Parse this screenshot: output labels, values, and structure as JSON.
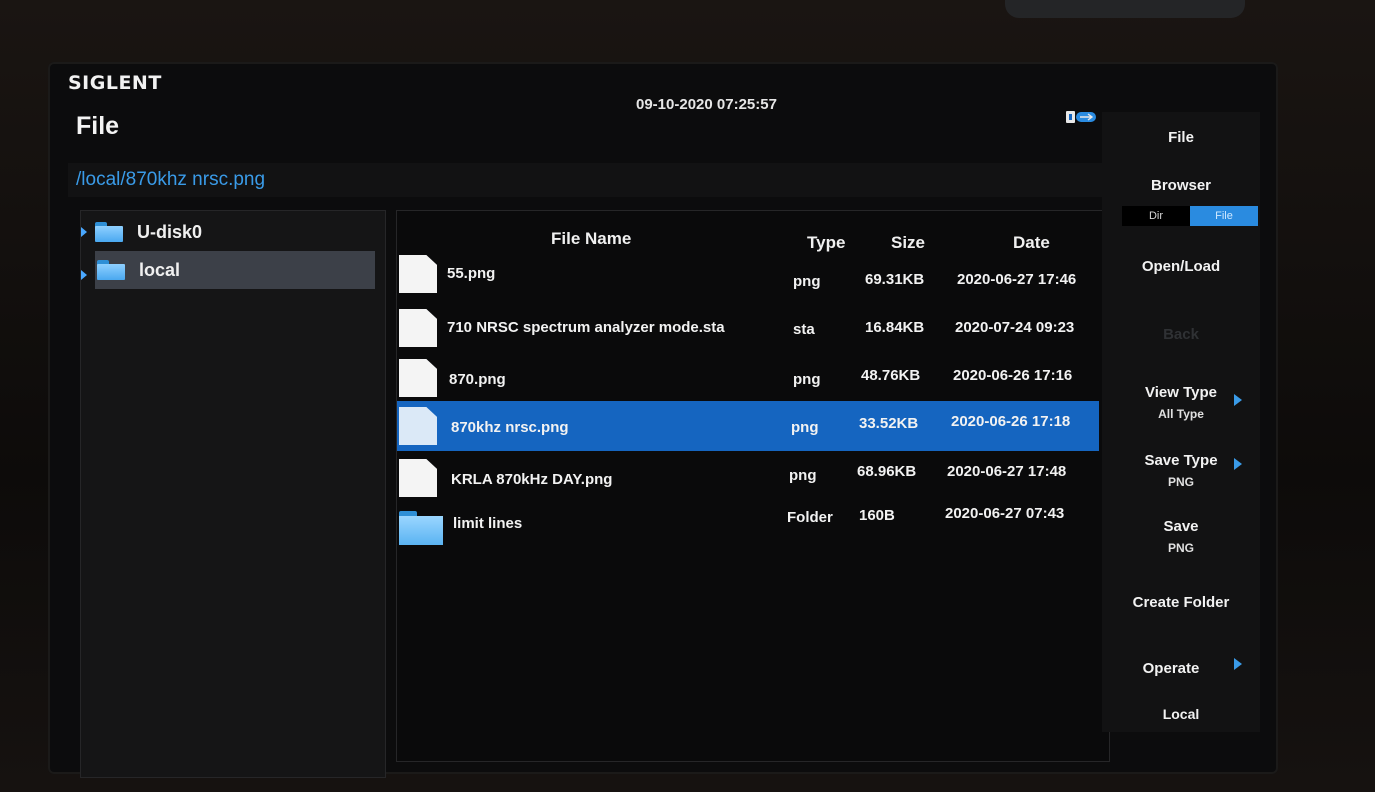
{
  "header": {
    "brand": "SIGLENT",
    "title": "File",
    "datetime": "09-10-2020 07:25:57"
  },
  "path": "/local/870khz nrsc.png",
  "tree": [
    {
      "label": "U-disk0",
      "selected": false
    },
    {
      "label": "local",
      "selected": true
    }
  ],
  "columns": {
    "name": "File Name",
    "type": "Type",
    "size": "Size",
    "date": "Date"
  },
  "files": [
    {
      "name": "55.png",
      "type": "png",
      "size": "69.31KB",
      "date": "2020-06-27 17:46",
      "icon": "file-icon"
    },
    {
      "name": "710 NRSC spectrum analyzer mode.sta",
      "type": "sta",
      "size": "16.84KB",
      "date": "2020-07-24 09:23",
      "icon": "file-icon"
    },
    {
      "name": "870.png",
      "type": "png",
      "size": "48.76KB",
      "date": "2020-06-26 17:16",
      "icon": "file-icon"
    },
    {
      "name": "870khz nrsc.png",
      "type": "png",
      "size": "33.52KB",
      "date": "2020-06-26 17:18",
      "icon": "file-icon",
      "selected": true
    },
    {
      "name": "KRLA 870kHz DAY.png",
      "type": "png",
      "size": "68.96KB",
      "date": "2020-06-27 17:48",
      "icon": "file-icon"
    },
    {
      "name": "limit lines",
      "type": "Folder",
      "size": "160B",
      "date": "2020-06-27 07:43",
      "icon": "folder-icon"
    }
  ],
  "menu": {
    "file": "File",
    "browser": "Browser",
    "dir": "Dir",
    "file_toggle": "File",
    "open_load": "Open/Load",
    "back": "Back",
    "view_type": "View Type",
    "view_type_value": "All Type",
    "save_type": "Save Type",
    "save_type_value": "PNG",
    "save": "Save",
    "save_value": "PNG",
    "create_folder": "Create Folder",
    "operate": "Operate",
    "local": "Local"
  },
  "colors": {
    "accent": "#3a9be8",
    "selection": "#1565c0"
  }
}
